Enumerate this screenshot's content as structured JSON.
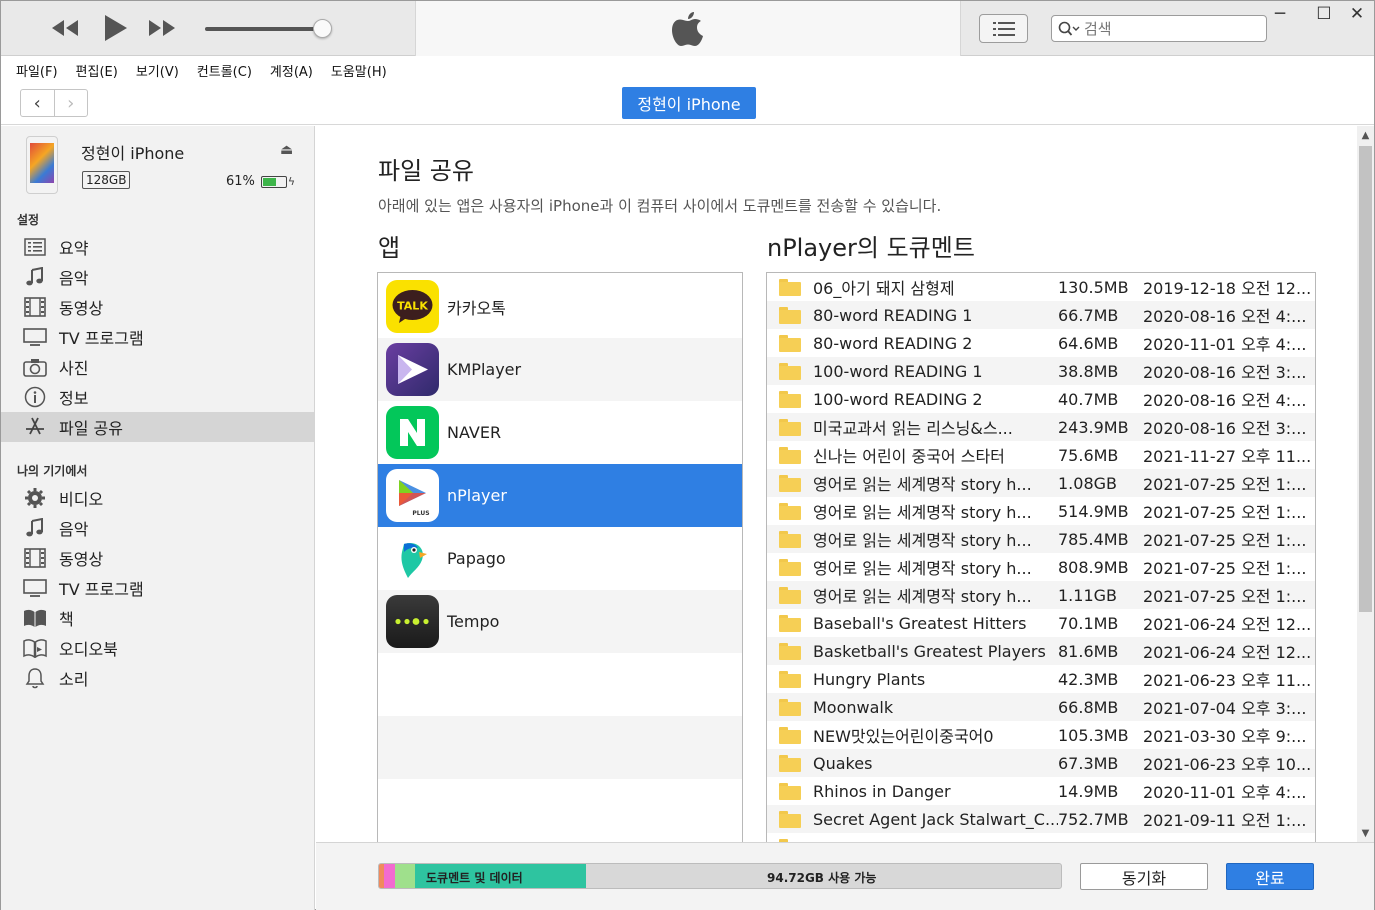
{
  "search": {
    "placeholder": "검색"
  },
  "menu": [
    "파일(F)",
    "편집(E)",
    "보기(V)",
    "컨트롤(C)",
    "계정(A)",
    "도움말(H)"
  ],
  "nav": {
    "device_button": "정현이 iPhone"
  },
  "device": {
    "name": "정현이 iPhone",
    "capacity": "128GB",
    "battery_text": "61%",
    "battery_level": 0.61
  },
  "sidebar": {
    "settings_title": "설정",
    "settings": [
      {
        "label": "요약",
        "icon": "summary-icon"
      },
      {
        "label": "음악",
        "icon": "music-note-icon"
      },
      {
        "label": "동영상",
        "icon": "film-icon"
      },
      {
        "label": "TV 프로그램",
        "icon": "tv-icon"
      },
      {
        "label": "사진",
        "icon": "camera-icon"
      },
      {
        "label": "정보",
        "icon": "info-icon"
      },
      {
        "label": "파일 공유",
        "icon": "app-store-icon",
        "active": true
      }
    ],
    "my_devices_title": "나의 기기에서",
    "my_devices": [
      {
        "label": "비디오",
        "icon": "gear-icon"
      },
      {
        "label": "음악",
        "icon": "music-note-icon"
      },
      {
        "label": "동영상",
        "icon": "film-icon"
      },
      {
        "label": "TV 프로그램",
        "icon": "tv-icon"
      },
      {
        "label": "책",
        "icon": "book-icon"
      },
      {
        "label": "오디오북",
        "icon": "audiobook-icon"
      },
      {
        "label": "소리",
        "icon": "bell-icon"
      }
    ]
  },
  "main": {
    "title": "파일 공유",
    "subtitle": "아래에 있는 앱은 사용자의 iPhone과 이 컴퓨터 사이에서 도큐멘트를 전송할 수 있습니다.",
    "apps_title": "앱",
    "docs_title": "nPlayer의 도큐멘트",
    "apps": [
      {
        "name": "카카오톡",
        "icon": "kakaotalk-icon"
      },
      {
        "name": "KMPlayer",
        "icon": "kmplayer-icon"
      },
      {
        "name": "NAVER",
        "icon": "naver-icon"
      },
      {
        "name": "nPlayer",
        "icon": "nplayer-icon",
        "selected": true
      },
      {
        "name": "Papago",
        "icon": "papago-icon"
      },
      {
        "name": "Tempo",
        "icon": "tempo-icon"
      }
    ],
    "documents": [
      {
        "name": "06_아기 돼지 삼형제",
        "size": "130.5MB",
        "date": "2019-12-18 오전 12..."
      },
      {
        "name": "80-word READING 1",
        "size": "66.7MB",
        "date": "2020-08-16 오전 4:..."
      },
      {
        "name": "80-word READING 2",
        "size": "64.6MB",
        "date": "2020-11-01 오후 4:..."
      },
      {
        "name": "100-word READING 1",
        "size": "38.8MB",
        "date": "2020-08-16 오전 3:..."
      },
      {
        "name": "100-word READING 2",
        "size": "40.7MB",
        "date": "2020-08-16 오전 4:..."
      },
      {
        "name": "미국교과서 읽는 리스닝&스...",
        "size": "243.9MB",
        "date": "2020-08-16 오전 3:..."
      },
      {
        "name": "신나는 어린이 중국어 스타터",
        "size": "75.6MB",
        "date": "2021-11-27 오후 11..."
      },
      {
        "name": "영어로 읽는 세계명작 story h...",
        "size": "1.08GB",
        "date": "2021-07-25 오전 1:..."
      },
      {
        "name": "영어로 읽는 세계명작 story h...",
        "size": "514.9MB",
        "date": "2021-07-25 오전 1:..."
      },
      {
        "name": "영어로 읽는 세계명작 story h...",
        "size": "785.4MB",
        "date": "2021-07-25 오전 1:..."
      },
      {
        "name": "영어로 읽는 세계명작 story h...",
        "size": "808.9MB",
        "date": "2021-07-25 오전 1:..."
      },
      {
        "name": "영어로 읽는 세계명작 story h...",
        "size": "1.11GB",
        "date": "2021-07-25 오전 1:..."
      },
      {
        "name": "Baseball's Greatest Hitters",
        "size": "70.1MB",
        "date": "2021-06-24 오전 12..."
      },
      {
        "name": "Basketball's Greatest Players",
        "size": "81.6MB",
        "date": "2021-06-24 오전 12..."
      },
      {
        "name": "Hungry Plants",
        "size": "42.3MB",
        "date": "2021-06-23 오후 11..."
      },
      {
        "name": "Moonwalk",
        "size": "66.8MB",
        "date": "2021-07-04 오후 3:..."
      },
      {
        "name": "NEW맛있는어린이중국어0",
        "size": "105.3MB",
        "date": "2021-03-30 오후 9:..."
      },
      {
        "name": "Quakes",
        "size": "67.3MB",
        "date": "2021-06-23 오후 10..."
      },
      {
        "name": "Rhinos in Danger",
        "size": "14.9MB",
        "date": "2020-11-01 오후 4:..."
      },
      {
        "name": "Secret Agent Jack Stalwart_C...",
        "size": "752.7MB",
        "date": "2021-09-11 오전 1:..."
      }
    ]
  },
  "footer": {
    "docs_label": "도큐멘트 및 데이터",
    "free_label": "94.72GB 사용 가능",
    "sync_button": "동기화",
    "done_button": "완료",
    "storage_segments": [
      {
        "color": "#f08a5d",
        "fraction": 0.007
      },
      {
        "color": "#f26bd0",
        "fraction": 0.016
      },
      {
        "color": "#9fe08c",
        "fraction": 0.03
      },
      {
        "color": "#2ec4a0",
        "fraction": 0.25
      }
    ]
  },
  "colors": {
    "accent": "#2f7fe3",
    "selection": "#2f7fe3",
    "folder": "#f6cf55"
  }
}
